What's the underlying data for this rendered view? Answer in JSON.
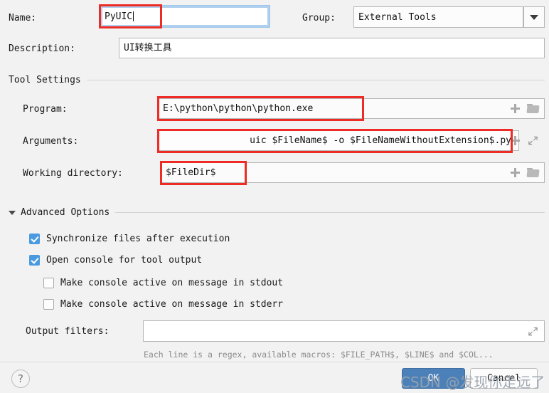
{
  "form": {
    "name_label": "Name:",
    "name_value": "PyUIC",
    "group_label": "Group:",
    "group_value": "External Tools",
    "group_options": [
      "External Tools"
    ],
    "description_label": "Description:",
    "description_value": "UI转换工具"
  },
  "tool_settings": {
    "section_title": "Tool Settings",
    "program_label": "Program:",
    "program_value": "E:\\python\\python\\python.exe",
    "arguments_label": "Arguments:",
    "arguments_value": "uic $FileName$ -o $FileNameWithoutExtension$.py",
    "working_dir_label": "Working directory:",
    "working_dir_value": "$FileDir$"
  },
  "advanced": {
    "section_title": "Advanced Options",
    "options": [
      {
        "label": "Synchronize files after execution",
        "checked": true
      },
      {
        "label": "Open console for tool output",
        "checked": true
      },
      {
        "label": "Make console active on message in stdout",
        "checked": false
      },
      {
        "label": "Make console active on message in stderr",
        "checked": false
      }
    ],
    "output_filters_label": "Output filters:",
    "output_filters_value": "",
    "output_filters_hint": "Each line is a regex, available macros: $FILE_PATH$, $LINE$ and $COL..."
  },
  "footer": {
    "help_label": "?",
    "ok_label": "OK",
    "cancel_label": "Cancel"
  },
  "watermark": {
    "text": "CSDN @发现你走远了"
  },
  "icons": {
    "insert_macro": "plus-icon",
    "browse": "folder-icon",
    "expand": "expand-icon",
    "dropdown": "chevron-down-icon",
    "collapse_toggle": "triangle-down-icon"
  },
  "colors": {
    "background": "#f2f2f2",
    "accent_checkbox": "#4a9ae1",
    "annotation": "#ee2b24",
    "primary_button": "#4b80b8",
    "focus_ring": "#aecfee"
  }
}
